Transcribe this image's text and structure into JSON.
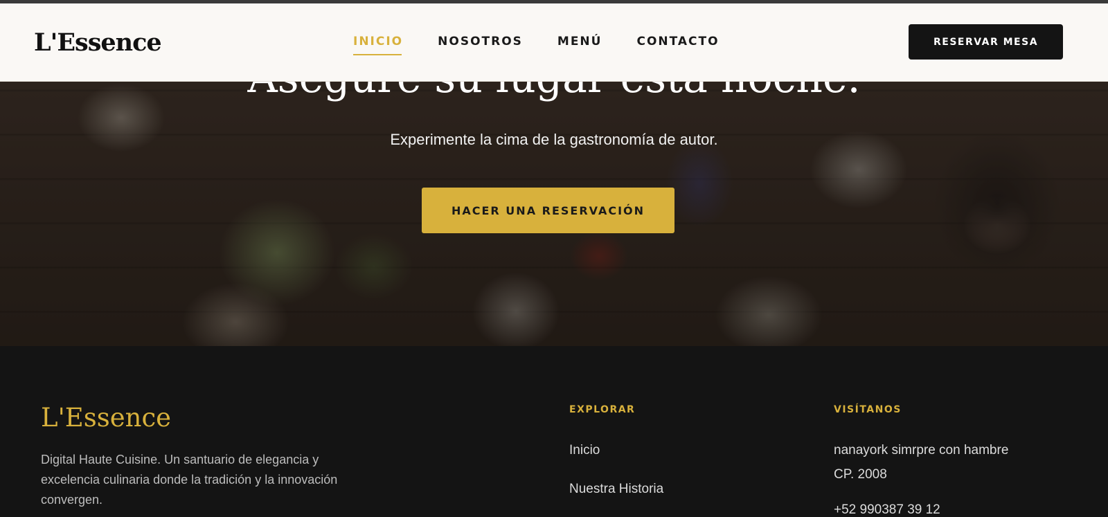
{
  "header": {
    "logo": "L'Essence",
    "nav": [
      {
        "label": "INICIO",
        "active": true
      },
      {
        "label": "NOSOTROS",
        "active": false
      },
      {
        "label": "MENÚ",
        "active": false
      },
      {
        "label": "CONTACTO",
        "active": false
      }
    ],
    "reserve_label": "RESERVAR MESA"
  },
  "hero": {
    "title": "Asegure su lugar esta noche.",
    "subtitle": "Experimente la cima de la gastronomía de autor.",
    "cta_label": "HACER UNA RESERVACIÓN"
  },
  "footer": {
    "logo": "L'Essence",
    "description": "Digital Haute Cuisine. Un santuario de elegancia y excelencia culinaria donde la tradición y la innovación convergen.",
    "explore": {
      "title": "EXPLORAR",
      "links": [
        "Inicio",
        "Nuestra Historia"
      ]
    },
    "visit": {
      "title": "VISÍTANOS",
      "address_line1": "nanayork simrpre con hambre",
      "address_line2": "CP. 2008",
      "phone": "+52 990387 39 12"
    }
  },
  "colors": {
    "accent": "#d8b13c",
    "dark": "#141414",
    "header_bg": "#faf8f5"
  }
}
